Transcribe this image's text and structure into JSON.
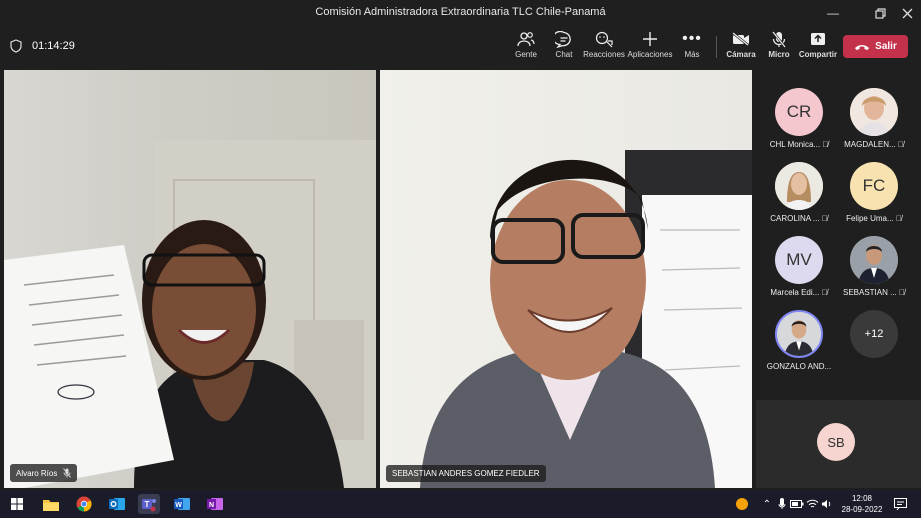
{
  "window": {
    "title": "Comisión Administradora Extraordinaria TLC Chile-Panamá",
    "controls": [
      "minimize",
      "restore",
      "close"
    ]
  },
  "toolbar": {
    "timer": "01:14:29",
    "people": "Gente",
    "chat": "Chat",
    "reactions": "Reacciones",
    "apps": "Aplicaciones",
    "more": "Más",
    "camera": "Cámara",
    "mic": "Micro",
    "share": "Compartir",
    "leave": "Salir"
  },
  "videos": [
    {
      "name": "Alvaro Ríos",
      "muted": true
    },
    {
      "name": "SEBASTIAN ANDRES GOMEZ FIEDLER",
      "muted": false
    }
  ],
  "participants": [
    {
      "initials": "CR",
      "name": "CHL Monica...",
      "muted": true,
      "photo": false,
      "color": "#f4c7cf"
    },
    {
      "initials": "",
      "name": "MAGDALEN...",
      "muted": true,
      "photo": true,
      "color": "#e9c8b6"
    },
    {
      "initials": "",
      "name": "CAROLINA ...",
      "muted": true,
      "photo": true,
      "color": "#d9c2a6"
    },
    {
      "initials": "FC",
      "name": "Felipe Uma...",
      "muted": true,
      "photo": false,
      "color": "#f8e3b0"
    },
    {
      "initials": "MV",
      "name": "Marcela Edi...",
      "muted": true,
      "photo": false,
      "color": "#ddd9ef"
    },
    {
      "initials": "",
      "name": "SEBASTIAN ...",
      "muted": true,
      "photo": true,
      "color": "#8b8f96"
    },
    {
      "initials": "",
      "name": "GONZALO AND...",
      "muted": false,
      "photo": true,
      "color": "#bfc3c9",
      "speaking": true
    },
    {
      "initials": "+12",
      "name": "",
      "muted": false,
      "photo": false,
      "color": "#3a3a3a",
      "overflow": true
    }
  ],
  "self_preview": {
    "initials": "SB"
  },
  "taskbar": {
    "apps": [
      "windows-start",
      "file-explorer",
      "chrome",
      "outlook",
      "teams",
      "word",
      "onenote"
    ],
    "time": "12:08",
    "date": "28-09-2022"
  }
}
